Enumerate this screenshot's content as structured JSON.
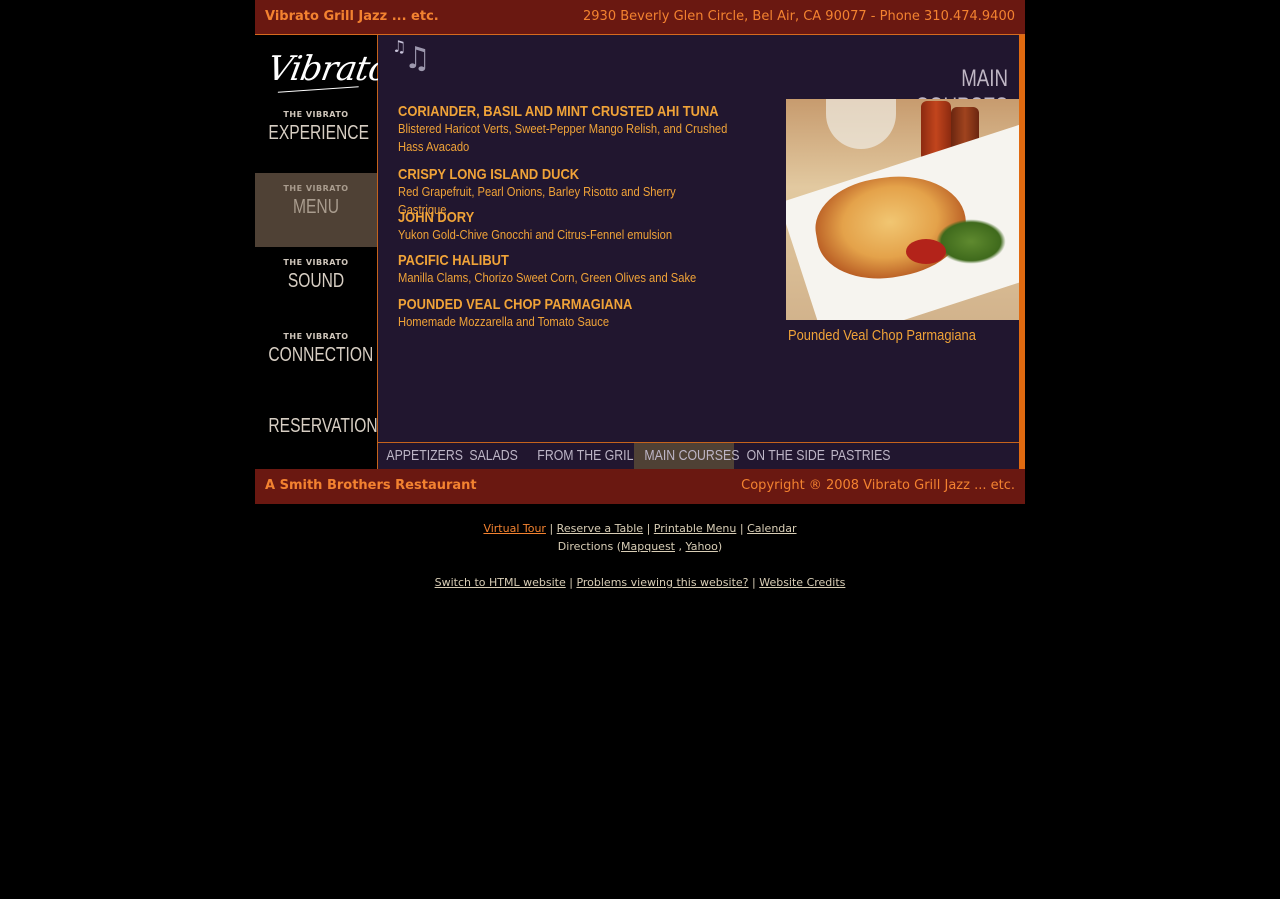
{
  "top_bar": {
    "title": "Vibrato Grill Jazz ... etc.",
    "address": "2930 Beverly Glen Circle, Bel Air, CA 90077 - Phone 310.474.9400"
  },
  "sidebar": {
    "logo": "Vibrato",
    "items": [
      {
        "small": "THE VIBRATO",
        "big": "EXPERIENCE"
      },
      {
        "small": "THE VIBRATO",
        "big": "MENU"
      },
      {
        "small": "THE VIBRATO",
        "big": "SOUND"
      },
      {
        "small": "THE VIBRATO",
        "big": "CONNECTION"
      },
      {
        "small": "",
        "big": "RESERVATIONS"
      }
    ],
    "active_index": 1
  },
  "content": {
    "section_title": "MAIN COURSES",
    "dishes": [
      {
        "name": "CORIANDER, BASIL AND MINT CRUSTED AHI TUNA",
        "desc": "Blistered Haricot Verts, Sweet-Pepper Mango Relish, and Crushed Hass Avacado"
      },
      {
        "name": "CRISPY LONG ISLAND DUCK",
        "desc": "Red Grapefruit, Pearl Onions, Barley Risotto and Sherry Gastrique"
      },
      {
        "name": "JOHN DORY",
        "desc": "Yukon Gold-Chive Gnocchi and Citrus-Fennel emulsion"
      },
      {
        "name": "PACIFIC HALIBUT",
        "desc": "Manilla Clams, Chorizo Sweet Corn, Green Olives and Sake"
      },
      {
        "name": "POUNDED VEAL CHOP PARMAGIANA",
        "desc": "Homemade Mozzarella and Tomato Sauce"
      }
    ],
    "photo_caption": "Pounded Veal Chop Parmagiana"
  },
  "tabs": {
    "items": [
      "APPETIZERS",
      "SALADS",
      "FROM THE GRILL",
      "MAIN COURSES",
      "ON THE SIDE",
      "PASTRIES"
    ],
    "active_index": 3
  },
  "bottom_bar": {
    "left": "A Smith Brothers Restaurant",
    "right": "Copyright ® 2008 Vibrato Grill Jazz ... etc."
  },
  "footer": {
    "virtual_tour": "Virtual Tour",
    "reserve": "Reserve a Table",
    "printable_menu": "Printable Menu",
    "calendar": "Calendar",
    "directions_label": "Directions (",
    "mapquest": "Mapquest",
    "yahoo": "Yahoo",
    "directions_close": ")",
    "separator": "|",
    "comma": ",",
    "switch_html": "Switch to HTML website",
    "problems": "Problems viewing this website?",
    "credits": "Website Credits"
  },
  "colors": {
    "bar_bg": "#6a1811",
    "accent_orange": "#f38230",
    "content_bg": "#21162f",
    "menu_text": "#f0a338",
    "active_bg": "#4f4135"
  }
}
